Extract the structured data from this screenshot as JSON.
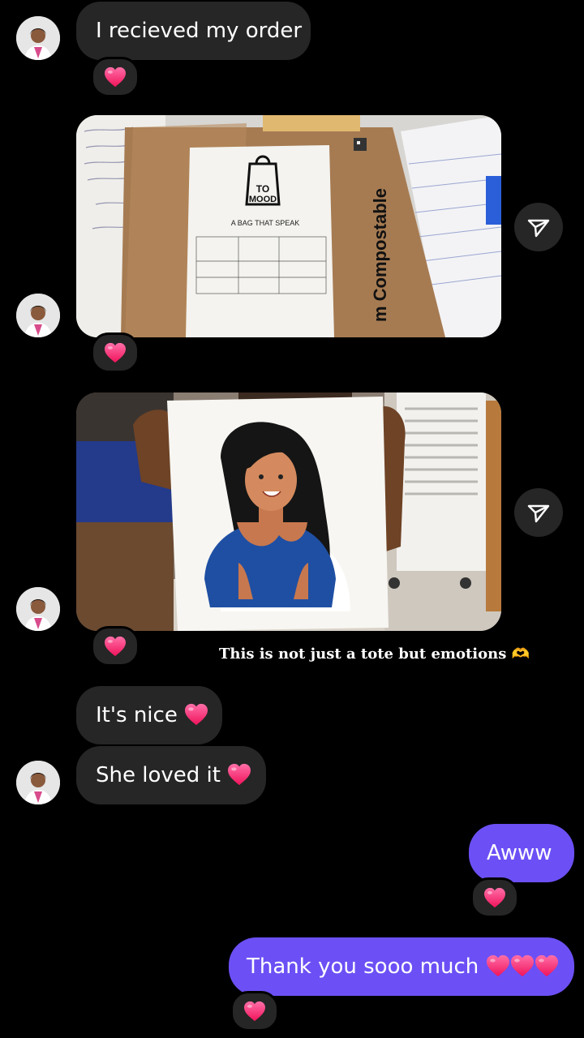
{
  "messages": {
    "m1": "I recieved my order",
    "m2": "It's nice",
    "m3": "She loved it",
    "m4": "Awww",
    "m5": "Thank you sooo much"
  },
  "photo1": {
    "bag_logo_top": "TO",
    "bag_logo_bottom": "MOOD",
    "bag_tagline": "A BAG THAT SPEAK",
    "packaging_text": "m Compostable"
  },
  "caption": "This is not just a tote but emotions 🫶",
  "icons": {
    "heart": "heart-icon",
    "share": "paper-plane-icon",
    "avatar": "avatar"
  },
  "colors": {
    "incoming_bubble": "#262626",
    "outgoing_bubble": "#6c50f5",
    "heart": "#ff2d6f",
    "background": "#000000"
  }
}
